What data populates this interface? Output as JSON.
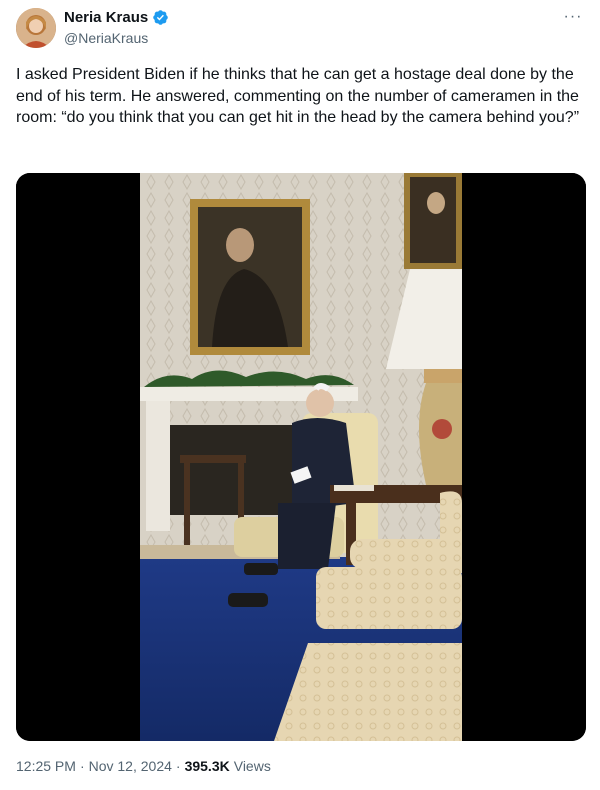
{
  "author": {
    "display_name": "Neria Kraus",
    "handle": "@NeriaKraus",
    "avatar_icon": "profile-avatar",
    "verified_icon": "verified-badge-icon",
    "verified_color": "#1d9bf0"
  },
  "more_menu": {
    "label": "···",
    "icon": "more-options-icon"
  },
  "tweet": {
    "text": "I asked President Biden if he thinks that he can get a hostage deal done by the end of his term. He answered, commenting on the number of cameramen in the room: “do you think that you can get hit in the head by the camera behind you?”"
  },
  "media": {
    "type": "video-still",
    "description_icon": "oval-office-video-frame"
  },
  "meta": {
    "time": "12:25 PM",
    "separator": "·",
    "date": "Nov 12, 2024",
    "views_count": "395.3K",
    "views_label": "Views"
  },
  "colors": {
    "text_primary": "#0f1419",
    "text_secondary": "#536471",
    "accent": "#1d9bf0"
  }
}
